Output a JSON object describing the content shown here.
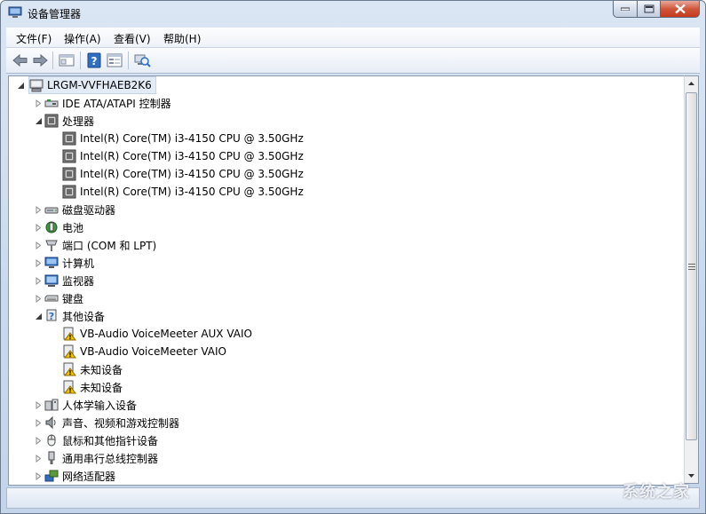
{
  "window": {
    "title": "设备管理器",
    "controls": [
      "minimize",
      "maximize",
      "close"
    ]
  },
  "menubar": {
    "items": [
      "文件(F)",
      "操作(A)",
      "查看(V)",
      "帮助(H)"
    ]
  },
  "toolbar": {
    "buttons": [
      "back-arrow-icon",
      "forward-arrow-icon",
      "show-hide-console-icon",
      "help-icon",
      "properties-icon",
      "scan-hardware-icon"
    ]
  },
  "tree": {
    "root": "LRGM-VVFHAEB2K6",
    "categories": [
      {
        "label": "IDE ATA/ATAPI 控制器",
        "expanded": false,
        "icon": "ide-controller-icon",
        "children": []
      },
      {
        "label": "处理器",
        "expanded": true,
        "icon": "processor-icon",
        "children": [
          {
            "label": "Intel(R) Core(TM) i3-4150 CPU @ 3.50GHz",
            "icon": "processor-icon"
          },
          {
            "label": "Intel(R) Core(TM) i3-4150 CPU @ 3.50GHz",
            "icon": "processor-icon"
          },
          {
            "label": "Intel(R) Core(TM) i3-4150 CPU @ 3.50GHz",
            "icon": "processor-icon"
          },
          {
            "label": "Intel(R) Core(TM) i3-4150 CPU @ 3.50GHz",
            "icon": "processor-icon"
          }
        ]
      },
      {
        "label": "磁盘驱动器",
        "expanded": false,
        "icon": "disk-drive-icon",
        "children": []
      },
      {
        "label": "电池",
        "expanded": false,
        "icon": "battery-icon",
        "children": []
      },
      {
        "label": "端口 (COM 和 LPT)",
        "expanded": false,
        "icon": "port-icon",
        "children": []
      },
      {
        "label": "计算机",
        "expanded": false,
        "icon": "computer-icon",
        "children": []
      },
      {
        "label": "监视器",
        "expanded": false,
        "icon": "monitor-icon",
        "children": []
      },
      {
        "label": "键盘",
        "expanded": false,
        "icon": "keyboard-icon",
        "children": []
      },
      {
        "label": "其他设备",
        "expanded": true,
        "icon": "other-devices-icon",
        "children": [
          {
            "label": "VB-Audio VoiceMeeter AUX VAIO",
            "icon": "warning-device-icon"
          },
          {
            "label": "VB-Audio VoiceMeeter VAIO",
            "icon": "warning-device-icon"
          },
          {
            "label": "未知设备",
            "icon": "warning-device-icon"
          },
          {
            "label": "未知设备",
            "icon": "warning-device-icon"
          }
        ]
      },
      {
        "label": "人体学输入设备",
        "expanded": false,
        "icon": "hid-icon",
        "children": []
      },
      {
        "label": "声音、视频和游戏控制器",
        "expanded": false,
        "icon": "sound-icon",
        "children": []
      },
      {
        "label": "鼠标和其他指针设备",
        "expanded": false,
        "icon": "mouse-icon",
        "children": []
      },
      {
        "label": "通用串行总线控制器",
        "expanded": false,
        "icon": "usb-icon",
        "children": []
      },
      {
        "label": "网络适配器",
        "expanded": false,
        "icon": "network-adapter-icon",
        "children": []
      }
    ]
  },
  "watermark": "系统之家",
  "colors": {
    "selection": "#e3ebf7",
    "close_button": "#c53a1d",
    "warning": "#f2c200"
  }
}
